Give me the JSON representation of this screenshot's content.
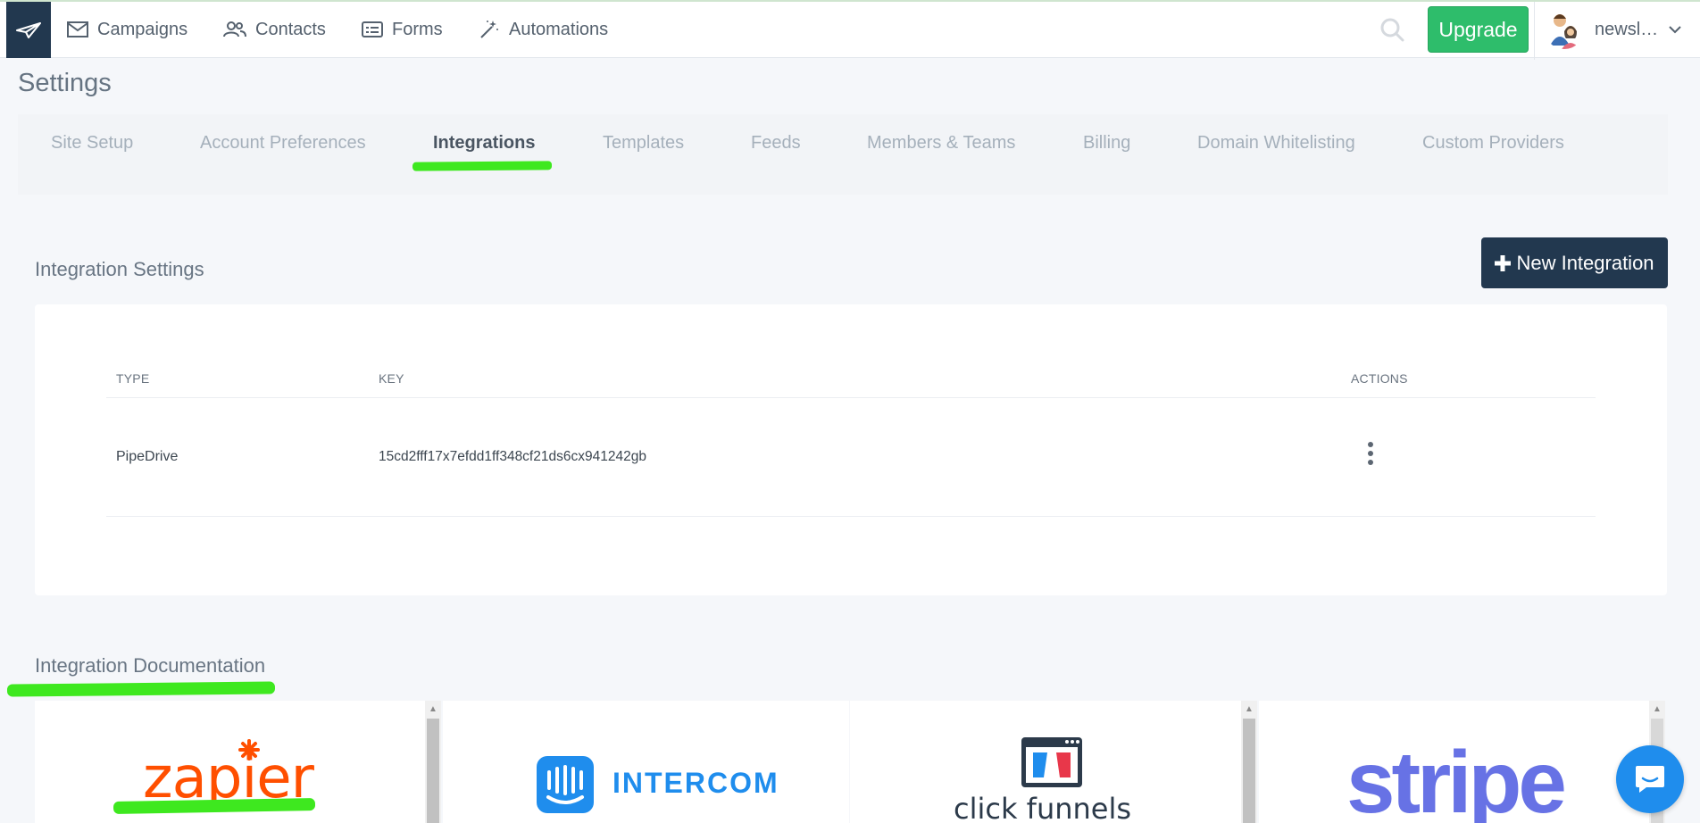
{
  "nav": {
    "items": [
      {
        "label": "Campaigns",
        "icon": "envelope-icon"
      },
      {
        "label": "Contacts",
        "icon": "users-icon"
      },
      {
        "label": "Forms",
        "icon": "form-icon"
      },
      {
        "label": "Automations",
        "icon": "magic-wand-icon"
      }
    ],
    "upgrade_label": "Upgrade",
    "user_name": "newsl…"
  },
  "page": {
    "title": "Settings"
  },
  "tabs": [
    {
      "label": "Site Setup",
      "active": false
    },
    {
      "label": "Account Preferences",
      "active": false
    },
    {
      "label": "Integrations",
      "active": true
    },
    {
      "label": "Templates",
      "active": false
    },
    {
      "label": "Feeds",
      "active": false
    },
    {
      "label": "Members & Teams",
      "active": false
    },
    {
      "label": "Billing",
      "active": false
    },
    {
      "label": "Domain Whitelisting",
      "active": false
    },
    {
      "label": "Custom Providers",
      "active": false
    }
  ],
  "integration_settings": {
    "title": "Integration Settings",
    "new_button_label": "New Integration",
    "columns": [
      "TYPE",
      "KEY",
      "ACTIONS"
    ],
    "rows": [
      {
        "type": "PipeDrive",
        "key": "15cd2fff17x7efdd1ff348cf21ds6cx941242gb"
      }
    ]
  },
  "integration_documentation": {
    "title": "Integration Documentation",
    "providers": [
      {
        "name": "zapier",
        "label": "zapier"
      },
      {
        "name": "intercom",
        "label": "INTERCOM"
      },
      {
        "name": "clickfunnels",
        "label": "click funnels"
      },
      {
        "name": "stripe",
        "label": "stripe"
      }
    ]
  },
  "colors": {
    "nav_dark": "#22384f",
    "upgrade_green": "#2ebd6b",
    "highlight_green": "#3ee81f",
    "chat_blue": "#1f8ded"
  }
}
